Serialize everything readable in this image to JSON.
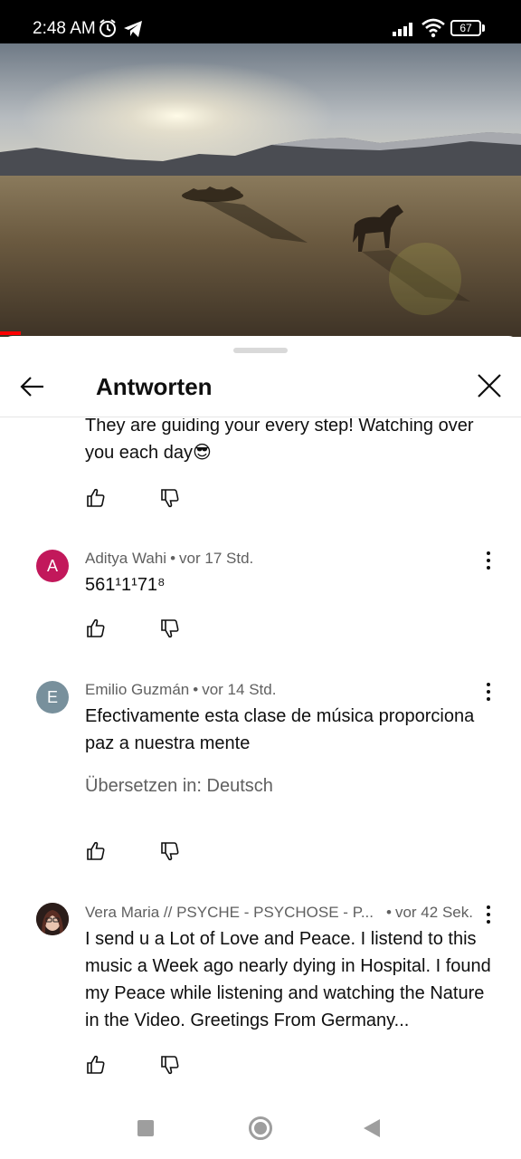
{
  "status_bar": {
    "time": "2:48 AM",
    "battery": "67"
  },
  "sheet": {
    "title": "Antworten"
  },
  "comments": [
    {
      "body": "They are guiding your every step! Watching over you each day😎"
    },
    {
      "avatar_letter": "A",
      "avatar_color": "#c2185b",
      "author": "Aditya Wahi",
      "time": "vor 17 Std.",
      "body": "561¹1¹71⁸"
    },
    {
      "avatar_letter": "E",
      "avatar_color": "#78909c",
      "author": "Emilio Guzmán",
      "time": "vor 14 Std.",
      "body": "Efectivamente esta clase de música proporciona paz a nuestra mente",
      "translate": "Übersetzen in: Deutsch"
    },
    {
      "author": "Vera Maria // PSYCHE - PSYCHOSE - P...",
      "time": "vor 42 Sek.",
      "body": "I send u a Lot of Love and Peace. I listend to this music a Week ago nearly dying in Hospital. I found my Peace while listening and watching the Nature in the Video. Greetings From Germany..."
    }
  ],
  "colors": {
    "accent": "#ff0000",
    "text_primary": "#0f0f0f",
    "text_secondary": "#606060"
  },
  "video": {
    "progress_fraction": 0.04
  }
}
